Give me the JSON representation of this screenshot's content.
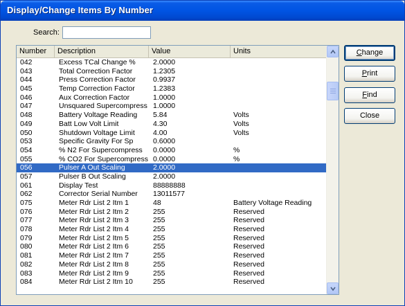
{
  "window": {
    "title": "Display/Change Items By Number"
  },
  "search": {
    "label": "Search:",
    "value": ""
  },
  "list": {
    "columns": [
      "Number",
      "Description",
      "Value",
      "Units"
    ],
    "rows": [
      {
        "number": "042",
        "description": "Excess TCal Change %",
        "value": "2.0000",
        "units": ""
      },
      {
        "number": "043",
        "description": "Total Correction Factor",
        "value": "1.2305",
        "units": ""
      },
      {
        "number": "044",
        "description": "Press Correction Factor",
        "value": "0.9937",
        "units": ""
      },
      {
        "number": "045",
        "description": "Temp Correction Factor",
        "value": "1.2383",
        "units": ""
      },
      {
        "number": "046",
        "description": "Aux Correction Factor",
        "value": "1.0000",
        "units": ""
      },
      {
        "number": "047",
        "description": "Unsquared Supercompress",
        "value": "1.0000",
        "units": ""
      },
      {
        "number": "048",
        "description": "Battery Voltage Reading",
        "value": "5.84",
        "units": "Volts"
      },
      {
        "number": "049",
        "description": "Batt Low Volt Limit",
        "value": "4.30",
        "units": "Volts"
      },
      {
        "number": "050",
        "description": "Shutdown Voltage Limit",
        "value": "4.00",
        "units": "Volts"
      },
      {
        "number": "053",
        "description": "Specific Gravity For Sp",
        "value": "0.6000",
        "units": ""
      },
      {
        "number": "054",
        "description": "% N2 For Supercompress",
        "value": "0.0000",
        "units": "%"
      },
      {
        "number": "055",
        "description": "% CO2 For Supercompress",
        "value": "0.0000",
        "units": "%"
      },
      {
        "number": "056",
        "description": "Pulser A Out Scaling",
        "value": "2.0000",
        "units": "",
        "selected": true
      },
      {
        "number": "057",
        "description": "Pulser B Out Scaling",
        "value": "2.0000",
        "units": ""
      },
      {
        "number": "061",
        "description": "Display Test",
        "value": "88888888",
        "units": ""
      },
      {
        "number": "062",
        "description": "Corrector Serial Number",
        "value": "13011577",
        "units": ""
      },
      {
        "number": "075",
        "description": "Meter Rdr List 2 Itm 1",
        "value": "48",
        "units": "Battery Voltage Reading"
      },
      {
        "number": "076",
        "description": "Meter Rdr List 2 Itm 2",
        "value": "255",
        "units": "Reserved"
      },
      {
        "number": "077",
        "description": "Meter Rdr List 2 Itm 3",
        "value": "255",
        "units": "Reserved"
      },
      {
        "number": "078",
        "description": "Meter Rdr List 2 Itm 4",
        "value": "255",
        "units": "Reserved"
      },
      {
        "number": "079",
        "description": "Meter Rdr List 2 Itm 5",
        "value": "255",
        "units": "Reserved"
      },
      {
        "number": "080",
        "description": "Meter Rdr List 2 Itm 6",
        "value": "255",
        "units": "Reserved"
      },
      {
        "number": "081",
        "description": "Meter Rdr List 2 Itm 7",
        "value": "255",
        "units": "Reserved"
      },
      {
        "number": "082",
        "description": "Meter Rdr List 2 Itm 8",
        "value": "255",
        "units": "Reserved"
      },
      {
        "number": "083",
        "description": "Meter Rdr List 2 Itm 9",
        "value": "255",
        "units": "Reserved"
      },
      {
        "number": "084",
        "description": "Meter Rdr List 2 Itm 10",
        "value": "255",
        "units": "Reserved"
      }
    ]
  },
  "buttons": {
    "change": {
      "hotkey": "C",
      "rest": "hange"
    },
    "print": {
      "hotkey": "P",
      "rest": "rint"
    },
    "find": {
      "hotkey": "F",
      "rest": "ind"
    },
    "close": {
      "label": "Close"
    }
  },
  "colors": {
    "titlebar": "#0054e3",
    "selection": "#316ac5",
    "dialog_bg": "#ece9d8"
  },
  "icons": {
    "scroll_up": "chevron-up-icon",
    "scroll_down": "chevron-down-icon"
  }
}
